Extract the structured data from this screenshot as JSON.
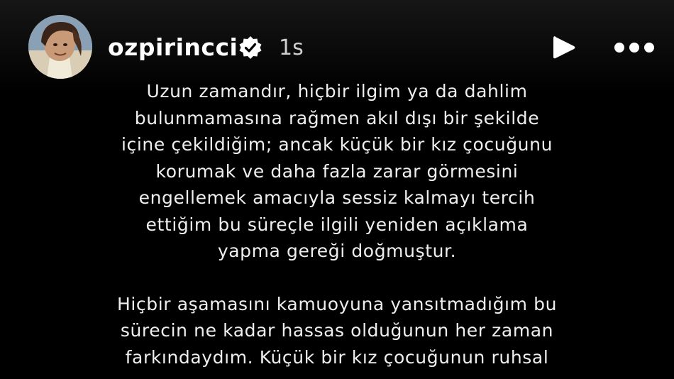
{
  "header": {
    "username": "ozpirincci",
    "time": "1s",
    "verified_icon": "verified-badge-icon",
    "play_icon": "play-icon",
    "more_icon": "more-dots-icon",
    "avatar_icon": "profile-avatar"
  },
  "story": {
    "paragraph1": [
      "Uzun zamandır, hiçbir ilgim ya da dahlim",
      "bulunmamasına rağmen akıl dışı bir şekilde",
      "içine çekildiğim; ancak küçük bir kız çocuğunu",
      "korumak ve daha fazla zarar görmesini",
      "engellemek amacıyla sessiz kalmayı tercih",
      "ettiğim bu süreçle ilgili yeniden açıklama",
      "yapma gereği doğmuştur."
    ],
    "paragraph2": [
      "Hiçbir aşamasını kamuoyuna yansıtmadığım bu",
      "sürecin ne kadar hassas olduğunun her zaman",
      "farkındaydım. Küçük bir kız çocuğunun ruhsal"
    ]
  },
  "colors": {
    "background": "#000000",
    "text": "#eeeeee",
    "username": "#ffffff",
    "time": "#d0d0d0"
  }
}
